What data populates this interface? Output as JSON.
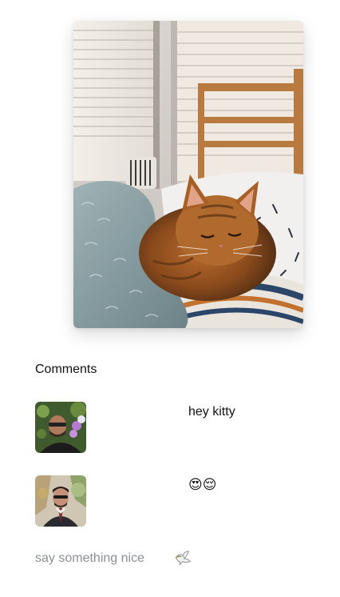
{
  "photo": {
    "alt": "cat sleeping on bed"
  },
  "comments": {
    "heading": "Comments",
    "items": [
      {
        "text": "hey kitty",
        "avatar": "man-with-sunglasses-in-garden"
      },
      {
        "text": "😍😌",
        "avatar": "man-in-suit-with-plants"
      }
    ]
  },
  "composer": {
    "placeholder": "say something nice",
    "value": "",
    "send_icon": "dove-icon"
  }
}
